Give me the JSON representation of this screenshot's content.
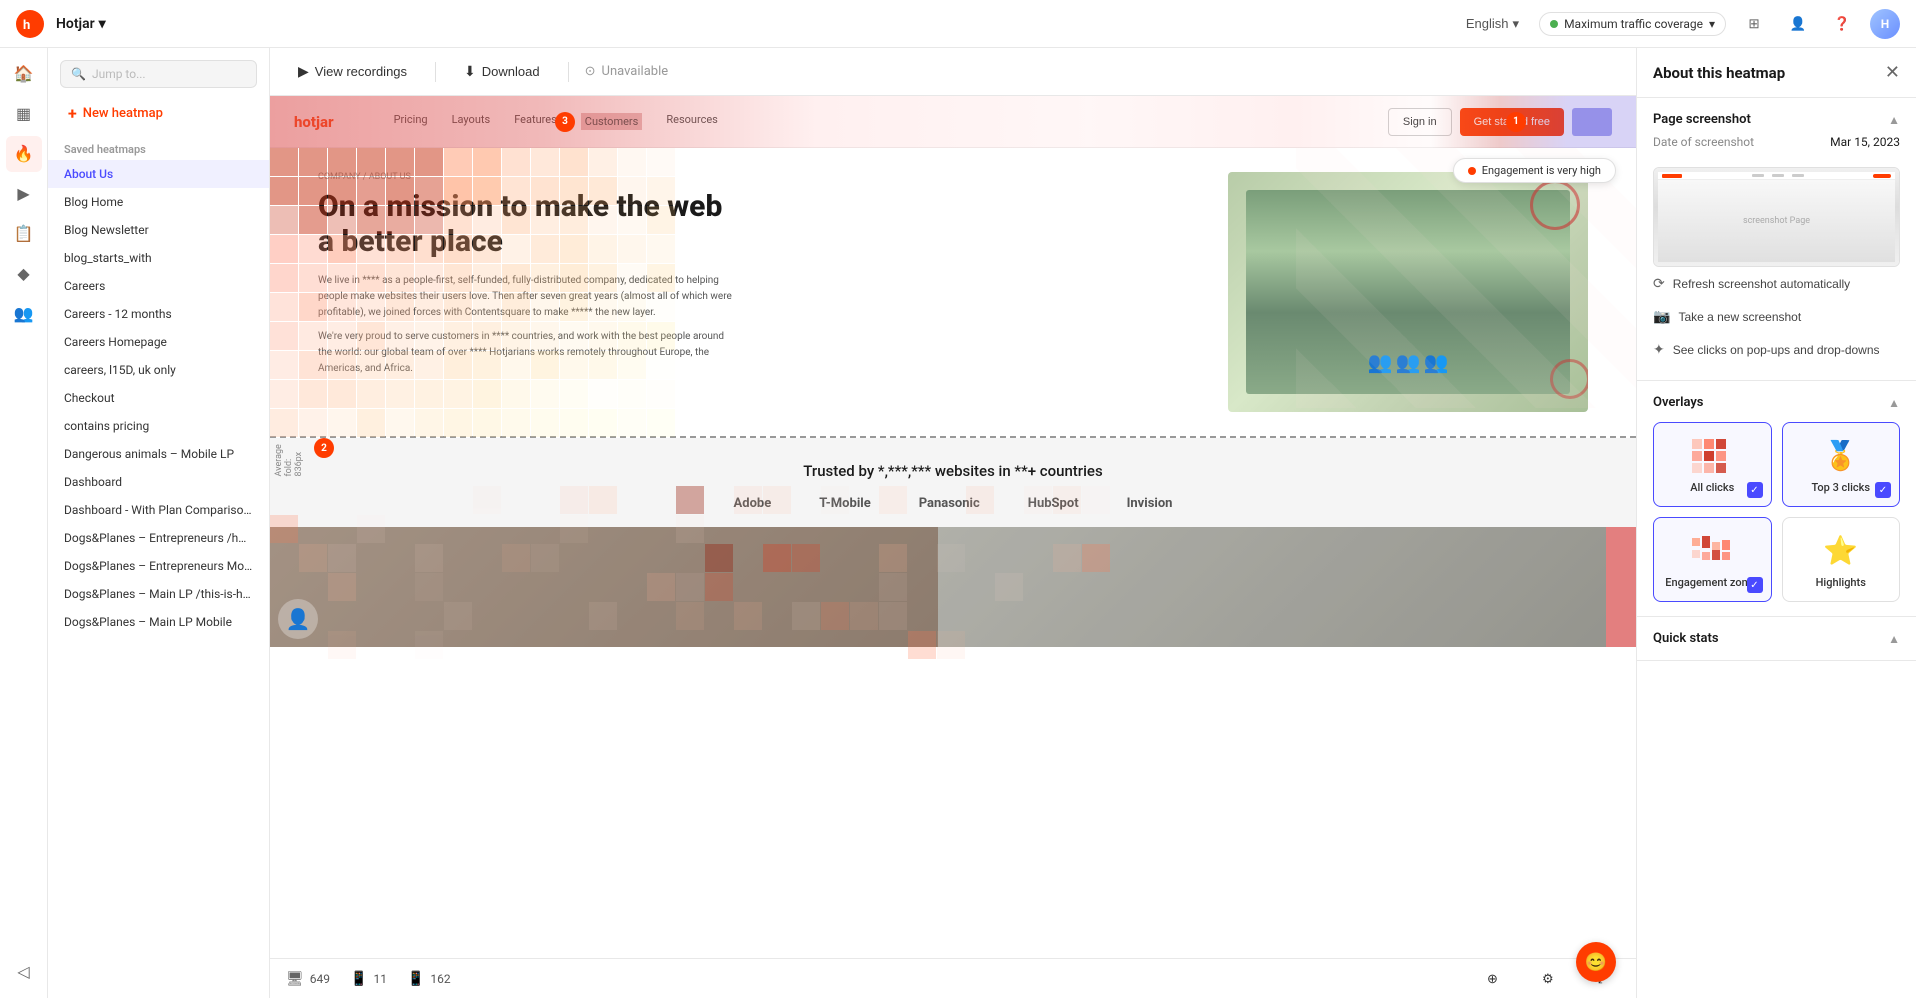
{
  "app": {
    "name": "Hotjar",
    "brand": "Hotjar",
    "brand_caret": "▾"
  },
  "topnav": {
    "language": "English",
    "traffic_coverage": "Maximum traffic coverage",
    "icons": [
      "grid-icon",
      "bell-icon",
      "user-icon",
      "help-icon",
      "avatar-icon"
    ]
  },
  "sidebar_icons": [
    {
      "name": "home-icon",
      "symbol": "⌂",
      "active": false
    },
    {
      "name": "dashboard-icon",
      "symbol": "▦",
      "active": false
    },
    {
      "name": "heatmap-icon",
      "symbol": "◉",
      "active": true
    },
    {
      "name": "recordings-icon",
      "symbol": "▶",
      "active": false
    },
    {
      "name": "surveys-icon",
      "symbol": "≡",
      "active": false
    },
    {
      "name": "insights-icon",
      "symbol": "◆",
      "active": false
    },
    {
      "name": "people-icon",
      "symbol": "👤",
      "active": false
    }
  ],
  "left_panel": {
    "search_placeholder": "Jump to...",
    "new_heatmap_label": "New heatmap",
    "section_title": "Saved heatmaps",
    "items": [
      {
        "label": "About Us",
        "active": true
      },
      {
        "label": "Blog Home",
        "active": false
      },
      {
        "label": "Blog Newsletter",
        "active": false
      },
      {
        "label": "blog_starts_with",
        "active": false
      },
      {
        "label": "Careers",
        "active": false
      },
      {
        "label": "Careers - 12 months",
        "active": false
      },
      {
        "label": "Careers Homepage",
        "active": false
      },
      {
        "label": "careers, l15D, uk only",
        "active": false
      },
      {
        "label": "Checkout",
        "active": false
      },
      {
        "label": "contains pricing",
        "active": false
      },
      {
        "label": "Dangerous animals – Mobile LP",
        "active": false
      },
      {
        "label": "Dashboard",
        "active": false
      },
      {
        "label": "Dashboard - With Plan Comparison (Traffic Coverage)",
        "active": false
      },
      {
        "label": "Dogs&Planes – Entrepreneurs /hotjar-x-entrepreneurs",
        "active": false
      },
      {
        "label": "Dogs&Planes – Entrepreneurs Mobile",
        "active": false
      },
      {
        "label": "Dogs&Planes – Main LP /this-is-hotjar",
        "active": false
      },
      {
        "label": "Dogs&Planes – Main LP Mobile",
        "active": false
      }
    ]
  },
  "toolbar": {
    "view_recordings_label": "View recordings",
    "download_label": "Download",
    "unavailable_label": "Unavailable"
  },
  "heatmap": {
    "breadcrumb": "COMPANY / ABOUT US",
    "hero_title": "On a mission to make the web a better place",
    "hero_text": "We live in **** as a people-first, self-funded, fully-distributed company, dedicated to helping people make websites their users love. Then after seven great years (almost all of which were profitable), we joined forces with Contentsquare to make ***** the new layer.",
    "hero_text2": "We're very proud to serve customers in **** countries, and work with the best people around the world: our global team of over **** Hotjarians works remotely throughout Europe, the Americas, and Africa.",
    "nav_links": [
      "Pricing",
      "Layouts",
      "Features",
      "Customers",
      "Resources"
    ],
    "nav_badge1": "3",
    "nav_badge2": "1",
    "sign_in": "Sign in",
    "get_started": "Get started free",
    "trusted_text": "Trusted by *,***,*** websites in **+ countries",
    "logos": [
      "Adobe",
      "T-Mobile",
      "Panasonic",
      "HubSpot",
      "Invision"
    ],
    "fold_label": "Average fold: 836px",
    "engagement_label": "Engagement is very high"
  },
  "stats_bar": {
    "desktop_count": "649",
    "tablet_count": "11",
    "mobile_count": "162",
    "filter_icon": "⊕",
    "settings_icon": "⚙"
  },
  "right_panel": {
    "title": "About this heatmap",
    "page_screenshot_label": "Page screenshot",
    "date_label": "Date of screenshot",
    "date_value": "Mar 15, 2023",
    "refresh_label": "Refresh screenshot automatically",
    "take_screenshot_label": "Take a new screenshot",
    "see_clicks_label": "See clicks on pop-ups and drop-downs",
    "overlays_label": "Overlays",
    "overlay_items": [
      {
        "label": "All clicks",
        "icon": "🎯",
        "active": true,
        "checked": true
      },
      {
        "label": "Top 3 clicks",
        "icon": "🏅",
        "active": true,
        "checked": true
      },
      {
        "label": "Engagement zones",
        "icon": "⬛",
        "active": true,
        "checked": true
      },
      {
        "label": "Highlights",
        "icon": "⭐",
        "active": false,
        "checked": false
      }
    ],
    "quick_stats_label": "Quick stats"
  }
}
